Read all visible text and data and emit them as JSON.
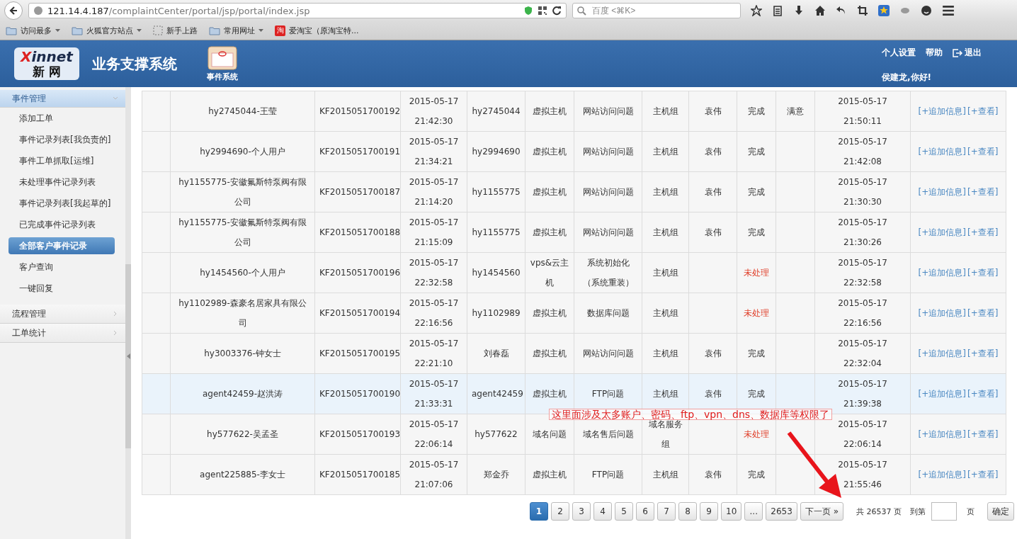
{
  "browser": {
    "url_host": "121.14.4.187",
    "url_path": "/complaintCenter/portal/jsp/portal/index.jsp",
    "search": {
      "placeholder": "百度 <⌘K>"
    },
    "bookmarks": [
      {
        "label": "访问最多",
        "kind": "folder",
        "menu": true
      },
      {
        "label": "火狐官方站点",
        "kind": "folder",
        "menu": true
      },
      {
        "label": "新手上路",
        "kind": "page",
        "menu": false
      },
      {
        "label": "常用网址",
        "kind": "folder",
        "menu": true
      },
      {
        "label": "爱淘宝（原淘宝特...",
        "kind": "shop",
        "badge": "淘",
        "menu": false
      }
    ]
  },
  "header": {
    "logo": {
      "latin": "Xinnet",
      "chinese": "新 网"
    },
    "system_title": "业务支撑系统",
    "module": "事件系统",
    "links": [
      "个人设置",
      "帮助",
      "退出"
    ],
    "greeting": "侯建龙,你好!"
  },
  "sidebar": {
    "groups": [
      {
        "label": "事件管理",
        "expanded": true,
        "items": [
          {
            "label": "添加工单",
            "selected": false
          },
          {
            "label": "事件记录列表[我负责的]",
            "selected": false
          },
          {
            "label": "事件工单抓取[运维]",
            "selected": false
          },
          {
            "label": "未处理事件记录列表",
            "selected": false
          },
          {
            "label": "事件记录列表[我起草的]",
            "selected": false
          },
          {
            "label": "已完成事件记录列表",
            "selected": false
          },
          {
            "label": "全部客户事件记录",
            "selected": true
          },
          {
            "label": "客户查询",
            "selected": false
          },
          {
            "label": "一键回复",
            "selected": false
          }
        ]
      },
      {
        "label": "流程管理",
        "expanded": false
      },
      {
        "label": "工单统计",
        "expanded": false
      }
    ]
  },
  "table": {
    "rows": [
      {
        "customer": "hy2745044-王莹",
        "ticket": "KF2015051700192",
        "created": "2015-05-17 21:42:30",
        "account": "hy2745044",
        "product": "虚拟主机",
        "category": "网站访问问题",
        "group": "主机组",
        "handler": "袁伟",
        "status": "完成",
        "pending": false,
        "rating": "满意",
        "closed": "2015-05-17 21:50:11",
        "actions": [
          "[+追加信息]",
          "[+查看]"
        ],
        "selected": false
      },
      {
        "customer": "hy2994690-个人用户",
        "ticket": "KF2015051700191",
        "created": "2015-05-17 21:34:21",
        "account": "hy2994690",
        "product": "虚拟主机",
        "category": "网站访问问题",
        "group": "主机组",
        "handler": "袁伟",
        "status": "完成",
        "pending": false,
        "closed": "2015-05-17 21:42:08",
        "actions": [
          "[+追加信息]",
          "[+查看]"
        ],
        "selected": false
      },
      {
        "customer": "hy1155775-安徽氟斯特泵阀有限公司",
        "ticket": "KF2015051700187",
        "created": "2015-05-17 21:14:20",
        "account": "hy1155775",
        "product": "虚拟主机",
        "category": "网站访问问题",
        "group": "主机组",
        "handler": "袁伟",
        "status": "完成",
        "pending": false,
        "closed": "2015-05-17 21:30:30",
        "actions": [
          "[+追加信息]",
          "[+查看]"
        ],
        "selected": false
      },
      {
        "customer": "hy1155775-安徽氟斯特泵阀有限公司",
        "ticket": "KF2015051700188",
        "created": "2015-05-17 21:15:09",
        "account": "hy1155775",
        "product": "虚拟主机",
        "category": "网站访问问题",
        "group": "主机组",
        "handler": "袁伟",
        "status": "完成",
        "pending": false,
        "closed": "2015-05-17 21:30:26",
        "actions": [
          "[+追加信息]",
          "[+查看]"
        ],
        "selected": false
      },
      {
        "customer": "hy1454560-个人用户",
        "ticket": "KF2015051700196",
        "created": "2015-05-17 22:32:58",
        "account": "hy1454560",
        "product": "vps&云主机",
        "category": "系统初始化（系统重装）",
        "group": "主机组",
        "status": "未处理",
        "pending": true,
        "closed": "2015-05-17 22:32:58",
        "actions": [
          "[+追加信息]",
          "[+查看]"
        ],
        "selected": false
      },
      {
        "customer": "hy1102989-森豪名居家具有限公司",
        "ticket": "KF2015051700194",
        "created": "2015-05-17 22:16:56",
        "account": "hy1102989",
        "product": "虚拟主机",
        "category": "数据库问题",
        "group": "主机组",
        "status": "未处理",
        "pending": true,
        "closed": "2015-05-17 22:16:56",
        "actions": [
          "[+追加信息]",
          "[+查看]"
        ],
        "selected": false
      },
      {
        "customer": "hy3003376-钟女士",
        "ticket": "KF2015051700195",
        "created": "2015-05-17 22:21:10",
        "account": "刘春磊",
        "product": "虚拟主机",
        "category": "网站访问问题",
        "group": "主机组",
        "handler": "袁伟",
        "status": "完成",
        "pending": false,
        "closed": "2015-05-17 22:32:04",
        "actions": [
          "[+追加信息]",
          "[+查看]"
        ],
        "selected": false
      },
      {
        "customer": "agent42459-赵洪涛",
        "ticket": "KF2015051700190",
        "created": "2015-05-17 21:33:31",
        "account": "agent42459",
        "product": "虚拟主机",
        "category": "FTP问题",
        "group": "主机组",
        "handler": "袁伟",
        "status": "完成",
        "pending": false,
        "closed": "2015-05-17 21:39:38",
        "actions": [
          "[+追加信息]",
          "[+查看]"
        ],
        "selected": true
      },
      {
        "customer": "hy577622-吴孟圣",
        "ticket": "KF2015051700193",
        "created": "2015-05-17 22:06:14",
        "account": "hy577622",
        "product": "域名问题",
        "category": "域名售后问题",
        "group": "域名服务组",
        "status": "未处理",
        "pending": true,
        "closed": "2015-05-17 22:06:14",
        "actions": [
          "[+追加信息]",
          "[+查看]"
        ],
        "selected": false
      },
      {
        "customer": "agent225885-李女士",
        "ticket": "KF2015051700185",
        "created": "2015-05-17 21:07:06",
        "account": "郑金乔",
        "product": "虚拟主机",
        "category": "FTP问题",
        "group": "主机组",
        "handler": "袁伟",
        "status": "完成",
        "pending": false,
        "closed": "2015-05-17 21:55:46",
        "actions": [
          "[+追加信息]",
          "[+查看]"
        ],
        "selected": false
      }
    ]
  },
  "pagination": {
    "pages": [
      {
        "label": "1",
        "selected": true
      },
      {
        "label": "2",
        "selected": false
      },
      {
        "label": "3",
        "selected": false
      },
      {
        "label": "4",
        "selected": false
      },
      {
        "label": "5",
        "selected": false
      },
      {
        "label": "6",
        "selected": false
      },
      {
        "label": "7",
        "selected": false
      },
      {
        "label": "8",
        "selected": false
      },
      {
        "label": "9",
        "selected": false
      },
      {
        "label": "10",
        "selected": false
      },
      {
        "label": "...",
        "selected": false
      },
      {
        "label": "2653",
        "selected": false
      }
    ],
    "next": "下一页 »",
    "total": "共 26537 页",
    "goto_label": "到第",
    "goto_unit": "页",
    "confirm": "确定"
  },
  "annotation": {
    "text": "这里面涉及太多账户、密码、ftp、vpn、dns、数据库等权限了"
  }
}
